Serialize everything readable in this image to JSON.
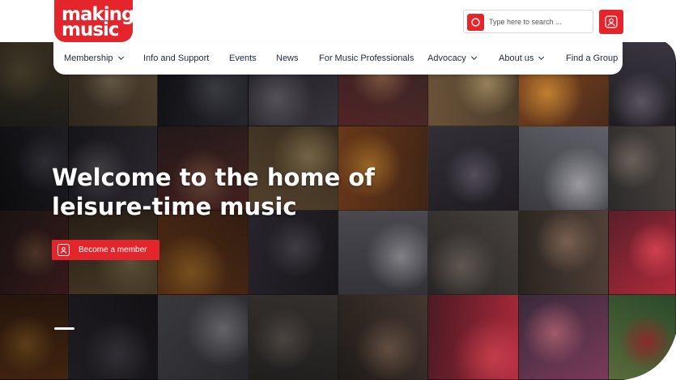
{
  "brand": {
    "logo_line1": "making",
    "logo_line2": "music",
    "accent": "#e4262c",
    "nav_text_color": "#1e2a4a"
  },
  "search": {
    "placeholder": "Type here to search ..."
  },
  "account": {
    "icon": "user-icon"
  },
  "nav": {
    "items": [
      {
        "label": "Membership",
        "dropdown": true
      },
      {
        "label": "Info and Support",
        "dropdown": false
      },
      {
        "label": "Events",
        "dropdown": false
      },
      {
        "label": "News",
        "dropdown": false
      },
      {
        "label": "For Music Professionals",
        "dropdown": false
      },
      {
        "label": "Advocacy",
        "dropdown": true
      },
      {
        "label": "About us",
        "dropdown": true
      },
      {
        "label": "Find a Group",
        "dropdown": false
      }
    ]
  },
  "hero": {
    "headline": "Welcome to the home of leisure-time music",
    "cta_label": "Become a member",
    "slides_visible": 1
  }
}
